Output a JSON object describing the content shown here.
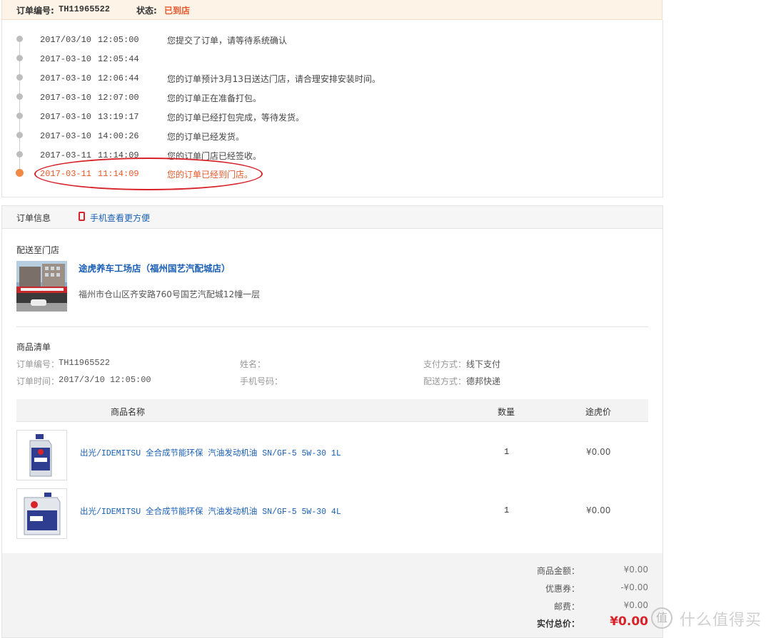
{
  "header": {
    "order_no_label": "订单编号:",
    "order_no": "TH11965522",
    "status_label": "状态:",
    "status": "已到店"
  },
  "timeline": [
    {
      "date": "2017/03/10",
      "time": "12:05:00",
      "msg": "您提交了订单，请等待系统确认"
    },
    {
      "date": "2017-03-10",
      "time": "12:05:44",
      "msg": ""
    },
    {
      "date": "2017-03-10",
      "time": "12:06:44",
      "msg": "您的订单预计3月13日送达门店，请合理安排安装时间。"
    },
    {
      "date": "2017-03-10",
      "time": "12:07:00",
      "msg": "您的订单正在准备打包。"
    },
    {
      "date": "2017-03-10",
      "time": "13:19:17",
      "msg": "您的订单已经打包完成，等待发货。"
    },
    {
      "date": "2017-03-10",
      "time": "14:00:26",
      "msg": "您的订单已经发货。"
    },
    {
      "date": "2017-03-11",
      "time": "11:14:09",
      "msg": "您的订单门店已经签收。"
    },
    {
      "date": "2017-03-11",
      "time": "11:14:09",
      "msg": "您的订单已经到门店。"
    }
  ],
  "info": {
    "tab_label": "订单信息",
    "phone_link": "手机查看更方便",
    "deliver_title": "配送至门店",
    "store_name": "途虎养车工场店（福州国艺汽配城店）",
    "store_addr": "福州市仓山区齐安路760号国艺汽配城12幢一层",
    "goods_title": "商品清单",
    "meta": {
      "order_no_label": "订单编号：",
      "order_no": "TH11965522",
      "order_time_label": "订单时间：",
      "order_time": "2017/3/10 12:05:00",
      "name_label": "姓名：",
      "phone_label": "手机号码：",
      "pay_label": "支付方式：",
      "pay": "线下支付",
      "ship_label": "配送方式：",
      "ship": "德邦快递"
    }
  },
  "table": {
    "col_name": "商品名称",
    "col_qty": "数量",
    "col_price": "途虎价",
    "rows": [
      {
        "name": "出光/IDEMITSU 全合成节能环保 汽油发动机油 SN/GF-5 5W-30 1L",
        "qty": "1",
        "price": "¥0.00"
      },
      {
        "name": "出光/IDEMITSU 全合成节能环保 汽油发动机油 SN/GF-5 5W-30 4L",
        "qty": "1",
        "price": "¥0.00"
      }
    ]
  },
  "totals": {
    "goods_label": "商品金额：",
    "goods": "¥0.00",
    "coupon_label": "优惠券：",
    "coupon": "-¥0.00",
    "ship_label": "邮费：",
    "ship": "¥0.00",
    "grand_label": "实付总价：",
    "grand": "¥0.00"
  },
  "watermark": {
    "mark": "值",
    "text": "什么值得买"
  },
  "colors": {
    "accent": "#e8572a",
    "link": "#1a5fb4",
    "price_red": "#d8232a"
  }
}
